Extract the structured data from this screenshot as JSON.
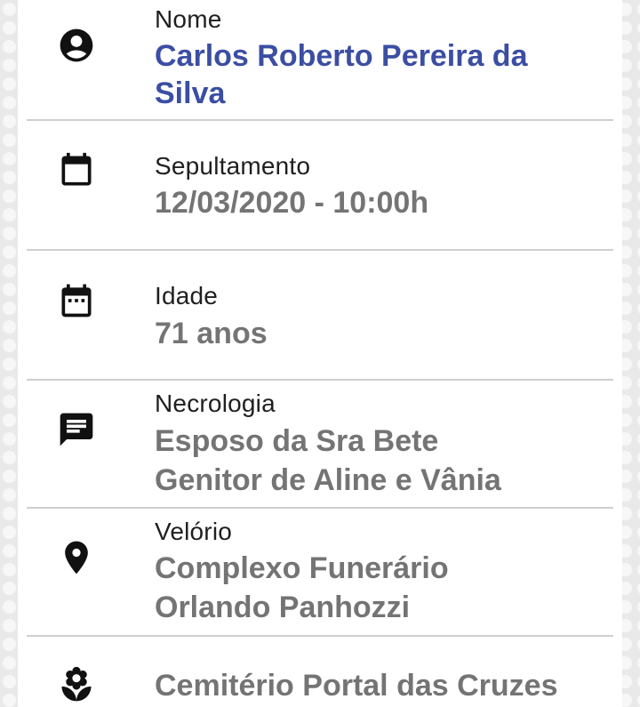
{
  "accent_color": "#3b4ea3",
  "text_color": "#747474",
  "rows": [
    {
      "icon": "account-circle-icon",
      "label": "Nome",
      "value_lines": [
        "Carlos Roberto Pereira da",
        "Silva"
      ]
    },
    {
      "icon": "calendar-icon",
      "label": "Sepultamento",
      "value_lines": [
        "12/03/2020 - 10:00h"
      ]
    },
    {
      "icon": "calendar-dots-icon",
      "label": "Idade",
      "value_lines": [
        "71 anos"
      ]
    },
    {
      "icon": "message-icon",
      "label": "Necrologia",
      "value_lines": [
        "Esposo da Sra Bete",
        "Genitor de Aline e Vânia"
      ]
    },
    {
      "icon": "map-pin-icon",
      "label": "Velório",
      "value_lines": [
        "Complexo Funerário",
        "Orlando Panhozzi"
      ]
    },
    {
      "icon": "flower-icon",
      "label": "",
      "value_lines": [
        "Cemitério Portal das Cruzes"
      ]
    }
  ]
}
